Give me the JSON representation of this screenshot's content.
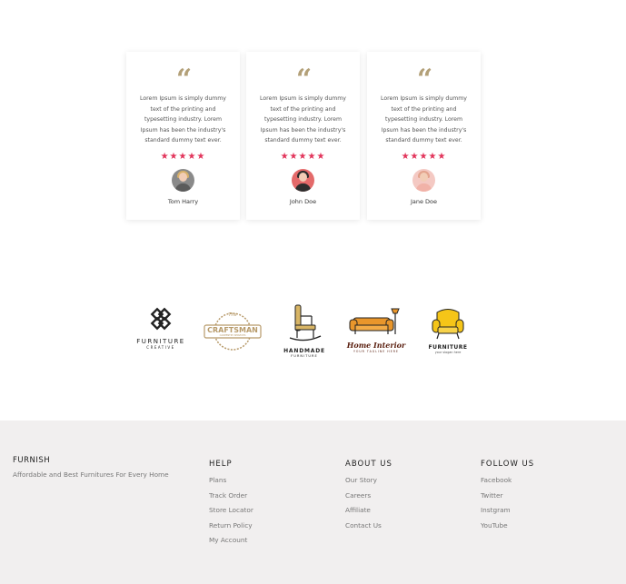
{
  "testimonials": [
    {
      "quote_mark": "“",
      "text": "Lorem Ipsum is simply dummy text of the printing and typesetting industry. Lorem Ipsum has been the industry's standard dummy text ever.",
      "rating": 4.5,
      "stars": "★★★★★",
      "name": "Tom Harry"
    },
    {
      "quote_mark": "“",
      "text": "Lorem Ipsum is simply dummy text of the printing and typesetting industry. Lorem Ipsum has been the industry's standard dummy text ever.",
      "rating": 4.5,
      "stars": "★★★★★",
      "name": "John Doe"
    },
    {
      "quote_mark": "“",
      "text": "Lorem Ipsum is simply dummy text of the printing and typesetting industry. Lorem Ipsum has been the industry's standard dummy text ever.",
      "rating": 4.5,
      "stars": "★★★★★",
      "name": "Jane Doe"
    }
  ],
  "partners": [
    {
      "title": "FURNITURE",
      "subtitle": "CREATIVE",
      "icon": "knot-pattern-icon"
    },
    {
      "title": "CRAFTSMAN",
      "subtitle": "CARPENTRY SERVICES",
      "top": "The",
      "icon": "saw-badge-icon"
    },
    {
      "title": "HANDMADE",
      "subtitle": "FURNITURE",
      "icon": "rocking-chair-icon"
    },
    {
      "title": "Home Interior",
      "subtitle": "YOUR TAGLINE HERE",
      "icon": "sofa-lamp-icon"
    },
    {
      "title": "FURNITURE",
      "subtitle": "your slogan here",
      "icon": "armchair-icon"
    }
  ],
  "footer": {
    "brand": "FURNISH",
    "tagline": "Affordable and Best Furnitures For Every Home",
    "columns": [
      {
        "heading": "HELP",
        "links": [
          "Plans",
          "Track Order",
          "Store Locator",
          "Return Policy",
          "My Account"
        ]
      },
      {
        "heading": "ABOUT US",
        "links": [
          "Our Story",
          "Careers",
          "Affiliate",
          "Contact Us"
        ]
      },
      {
        "heading": "FOLLOW US",
        "links": [
          "Facebook",
          "Twitter",
          "Instgram",
          "YouTube"
        ]
      }
    ]
  },
  "colors": {
    "quote": "#b3a078",
    "star": "#e2335a",
    "footer_bg": "#f1efef",
    "logo_gold": "#c29a3e",
    "logo_orange": "#e9962b"
  }
}
